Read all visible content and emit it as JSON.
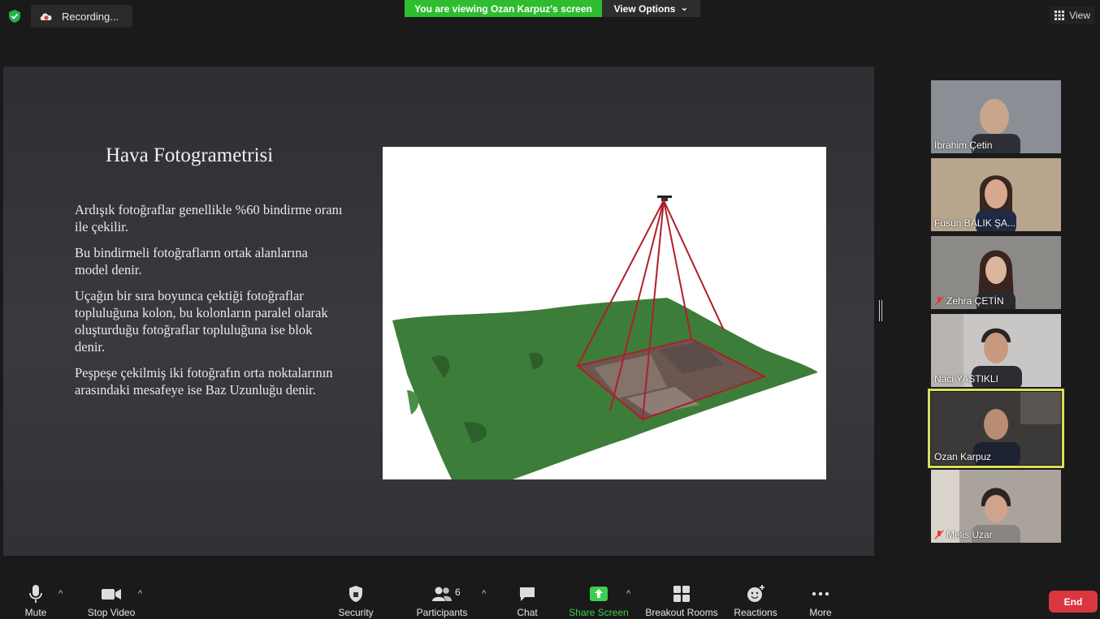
{
  "topbar": {
    "recording_label": "Recording...",
    "viewing_label": "You are viewing Ozan Karpuz's screen",
    "view_options_label": "View Options",
    "view_label": "View",
    "view_options_chevron": "⌄"
  },
  "slide": {
    "title": "Hava Fotogrametrisi",
    "paragraphs": [
      "Ardışık fotoğraflar genellikle %60 bindirme oranı ile çekilir.",
      "Bu bindirmeli fotoğrafların ortak alanlarına model denir.",
      "Uçağın bir sıra boyunca çektiği fotoğraflar topluluğuna kolon, bu kolonların paralel olarak oluşturduğu fotoğraflar topluluğuna ise blok denir.",
      "Peşpeşe çekilmiş iki fotoğrafın orta noktalarının arasındaki mesafeye ise Baz Uzunluğu denir."
    ]
  },
  "participants": [
    {
      "name": "İbrahim Çetin",
      "muted": false,
      "active": false,
      "bg": "#8a8f95"
    },
    {
      "name": "Fusun BALIK ŞA...",
      "muted": false,
      "active": false,
      "bg": "#b7a58d"
    },
    {
      "name": "Zehra ÇETİN",
      "muted": true,
      "active": false,
      "bg": "#8c8a87"
    },
    {
      "name": "Naci YASTIKLI",
      "muted": false,
      "active": false,
      "bg": "#c9c7c5"
    },
    {
      "name": "Ozan Karpuz",
      "muted": false,
      "active": true,
      "bg": "#3c3a38"
    },
    {
      "name": "Melis Uzar",
      "muted": true,
      "active": false,
      "bg": "#a9a39c"
    }
  ],
  "toolbar": {
    "mute": "Mute",
    "stop_video": "Stop Video",
    "security": "Security",
    "participants": "Participants",
    "participants_count": "6",
    "chat": "Chat",
    "share_screen": "Share Screen",
    "breakout_rooms": "Breakout Rooms",
    "reactions": "Reactions",
    "more": "More",
    "end": "End",
    "caret": "^"
  },
  "colors": {
    "green_banner": "#2fbd2f",
    "end_red": "#d9363e",
    "active_speaker_border": "#d7e05d",
    "share_green": "#3ccf4e",
    "terrain_green": "#3c7d3a",
    "footprint_red": "#b01e2a"
  }
}
